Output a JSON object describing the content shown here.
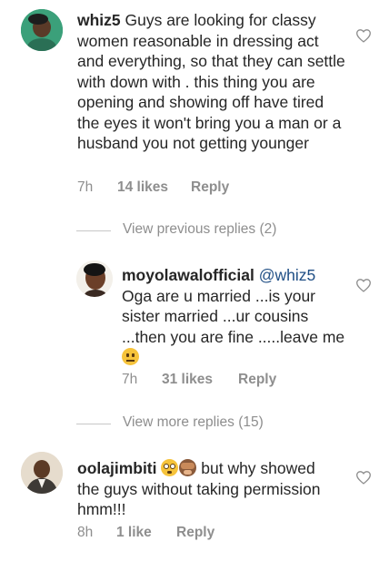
{
  "comments": [
    {
      "username": "whiz5",
      "text": "Guys are looking for classy women reasonable in dressing act and everything, so that they can settle with down with . this thing you are opening and showing off have tired the eyes it won't bring you a man or a husband you not getting younger",
      "time": "7h",
      "likes": "14 likes",
      "reply_label": "Reply"
    },
    {
      "username": "moyolawalofficial",
      "mention": "@whiz5",
      "text": "Oga are u married ...is your sister married ...ur cousins ...then you are fine .....leave me",
      "emoji": "neutral-face-emoji",
      "time": "7h",
      "likes": "31 likes",
      "reply_label": "Reply"
    },
    {
      "username": "oolajimbiti",
      "text": "but why showed the guys without taking permission hmm!!!",
      "emojis": [
        "flushed-face-emoji",
        "see-no-evil-monkey-emoji"
      ],
      "time": "8h",
      "likes": "1 like",
      "reply_label": "Reply"
    }
  ],
  "view_previous_replies": "View previous replies (2)",
  "view_more_replies": "View more replies (15)",
  "icons": {
    "like": "heart-outline-icon"
  },
  "colors": {
    "text": "#262626",
    "meta": "#8e8e8e",
    "mention": "#1f4e85"
  }
}
